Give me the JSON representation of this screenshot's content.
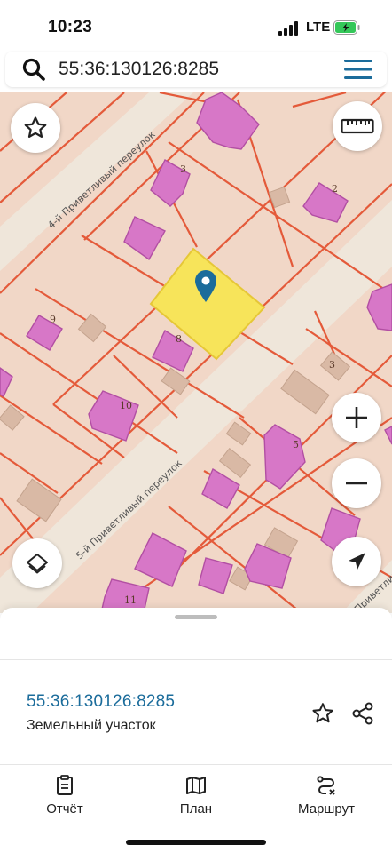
{
  "status_bar": {
    "time": "10:23",
    "network": "LTE",
    "battery_charging": true,
    "battery_color": "#34c759"
  },
  "search": {
    "query": "55:36:130126:8285",
    "icon": "search-icon",
    "menu_icon": "hamburger-menu-icon",
    "menu_color": "#1b6c9b"
  },
  "map": {
    "street_labels": [
      "4-й Приветливый переулок",
      "5-й Приветливый переулок",
      "Приветливый переулок"
    ],
    "house_numbers": [
      "3",
      "2",
      "9",
      "8",
      "3",
      "10",
      "5",
      "11"
    ],
    "selected_parcel_color": "#f7e45a",
    "building_color": "#d777c7",
    "boundary_color": "#e45a3a",
    "pin_color": "#1b6c9b",
    "controls": {
      "favorite": "star-outline-icon",
      "ruler": "ruler-icon",
      "zoom_in": "plus-icon",
      "zoom_out": "minus-icon",
      "layers": "layers-icon",
      "locate": "navigation-arrow-icon"
    }
  },
  "sheet": {
    "parcel_id": "55:36:130126:8285",
    "parcel_type": "Земельный участок",
    "parcel_id_color": "#1b6c9b"
  },
  "bottom_nav": {
    "items": [
      {
        "label": "Отчёт",
        "icon": "report-icon"
      },
      {
        "label": "План",
        "icon": "map-icon"
      },
      {
        "label": "Маршрут",
        "icon": "route-icon"
      }
    ]
  }
}
